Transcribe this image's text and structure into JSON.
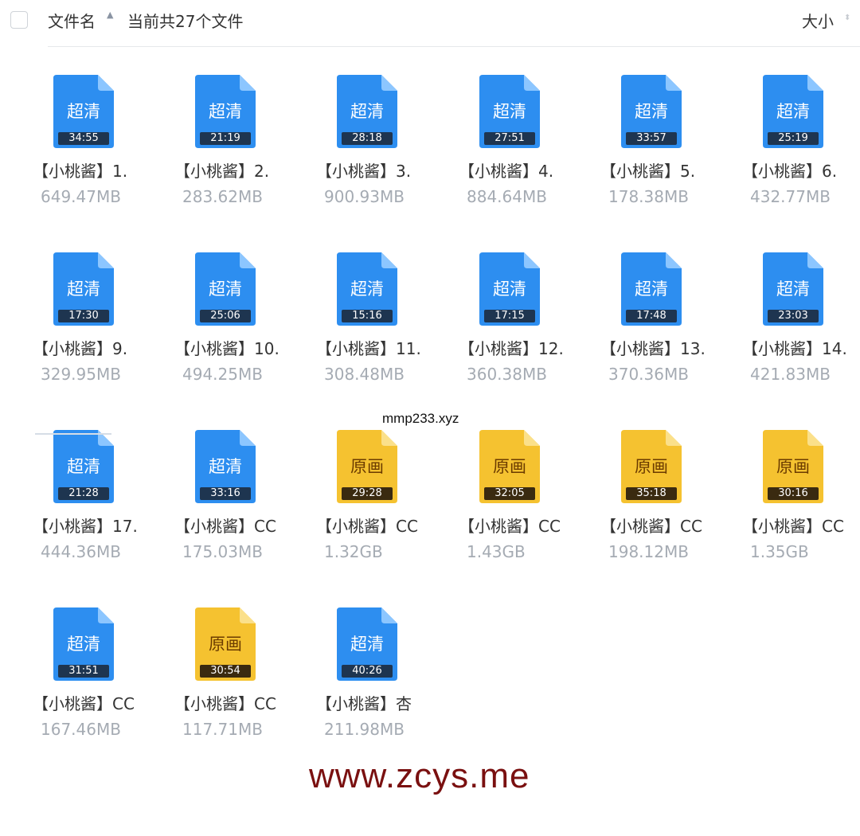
{
  "header": {
    "col_name_label": "文件名",
    "file_count": "当前共27个文件",
    "col_size_label": "大小"
  },
  "files": [
    {
      "badge": "超清",
      "duration": "34:55",
      "name": "【小桃酱】1.",
      "size": "649.47MB",
      "kind": "hd"
    },
    {
      "badge": "超清",
      "duration": "21:19",
      "name": "【小桃酱】2.",
      "size": "283.62MB",
      "kind": "hd"
    },
    {
      "badge": "超清",
      "duration": "28:18",
      "name": "【小桃酱】3.",
      "size": "900.93MB",
      "kind": "hd"
    },
    {
      "badge": "超清",
      "duration": "27:51",
      "name": "【小桃酱】4.",
      "size": "884.64MB",
      "kind": "hd"
    },
    {
      "badge": "超清",
      "duration": "33:57",
      "name": "【小桃酱】5.",
      "size": "178.38MB",
      "kind": "hd"
    },
    {
      "badge": "超清",
      "duration": "25:19",
      "name": "【小桃酱】6.",
      "size": "432.77MB",
      "kind": "hd"
    },
    {
      "badge": "超清",
      "duration": "17:30",
      "name": "【小桃酱】9.",
      "size": "329.95MB",
      "kind": "hd"
    },
    {
      "badge": "超清",
      "duration": "25:06",
      "name": "【小桃酱】10.",
      "size": "494.25MB",
      "kind": "hd"
    },
    {
      "badge": "超清",
      "duration": "15:16",
      "name": "【小桃酱】11.",
      "size": "308.48MB",
      "kind": "hd"
    },
    {
      "badge": "超清",
      "duration": "17:15",
      "name": "【小桃酱】12.",
      "size": "360.38MB",
      "kind": "hd"
    },
    {
      "badge": "超清",
      "duration": "17:48",
      "name": "【小桃酱】13.",
      "size": "370.36MB",
      "kind": "hd"
    },
    {
      "badge": "超清",
      "duration": "23:03",
      "name": "【小桃酱】14.",
      "size": "421.83MB",
      "kind": "hd"
    },
    {
      "badge": "超清",
      "duration": "21:28",
      "name": "【小桃酱】17.",
      "size": "444.36MB",
      "kind": "hd"
    },
    {
      "badge": "超清",
      "duration": "33:16",
      "name": "【小桃酱】CC",
      "size": "175.03MB",
      "kind": "hd"
    },
    {
      "badge": "原画",
      "duration": "29:28",
      "name": "【小桃酱】CC",
      "size": "1.32GB",
      "kind": "orig"
    },
    {
      "badge": "原画",
      "duration": "32:05",
      "name": "【小桃酱】CC",
      "size": "1.43GB",
      "kind": "orig"
    },
    {
      "badge": "原画",
      "duration": "35:18",
      "name": "【小桃酱】CC",
      "size": "198.12MB",
      "kind": "orig"
    },
    {
      "badge": "原画",
      "duration": "30:16",
      "name": "【小桃酱】CC",
      "size": "1.35GB",
      "kind": "orig"
    },
    {
      "badge": "超清",
      "duration": "31:51",
      "name": "【小桃酱】CC",
      "size": "167.46MB",
      "kind": "hd"
    },
    {
      "badge": "原画",
      "duration": "30:54",
      "name": "【小桃酱】CC",
      "size": "117.71MB",
      "kind": "orig"
    },
    {
      "badge": "超清",
      "duration": "40:26",
      "name": "【小桃酱】杏",
      "size": "211.98MB",
      "kind": "hd"
    }
  ],
  "colors": {
    "hd_icon": "#2d8ef0",
    "hd_fold": "#8cc6ff",
    "orig_icon": "#f5c230",
    "orig_fold": "#fbe08a"
  },
  "watermarks": {
    "top": "mmp233.xyz",
    "bottom": "www.zcys.me"
  }
}
